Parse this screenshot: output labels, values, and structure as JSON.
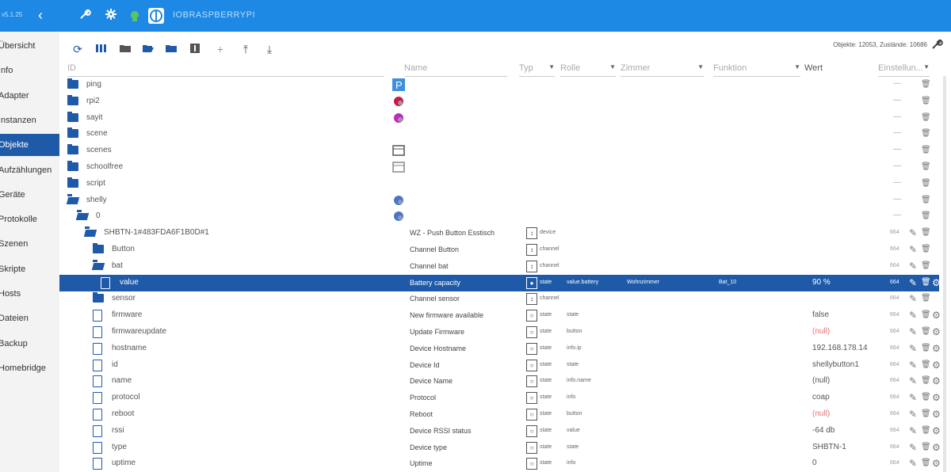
{
  "sidebar": {
    "version": "v5.1.25",
    "items": [
      {
        "label": "Übersicht",
        "active": false
      },
      {
        "label": "Info",
        "active": false
      },
      {
        "label": "Adapter",
        "active": false
      },
      {
        "label": "Instanzen",
        "active": false
      },
      {
        "label": "Objekte",
        "active": true
      },
      {
        "label": "Aufzählungen",
        "active": false
      },
      {
        "label": "Geräte",
        "active": false
      },
      {
        "label": "Protokolle",
        "active": false
      },
      {
        "label": "Szenen",
        "active": false
      },
      {
        "label": "Skripte",
        "active": false
      },
      {
        "label": "Hosts",
        "active": false
      },
      {
        "label": "Dateien",
        "active": false
      },
      {
        "label": "Backup",
        "active": false
      },
      {
        "label": "Homebridge",
        "active": false
      }
    ]
  },
  "topbar": {
    "host": "IOBRASPBERRYPI"
  },
  "main": {
    "counts": "Objekte: 12053, Zustände: 10686",
    "columns": {
      "id": "ID",
      "name": "Name",
      "type": "Typ",
      "role": "Rolle",
      "room": "Zimmer",
      "function": "Funktion",
      "value": "Wert",
      "settings": "Einstellun..."
    },
    "rows": [
      {
        "label": "ping",
        "icon": "folder",
        "level": 0
      },
      {
        "label": "rpi2",
        "icon": "folder",
        "level": 0
      },
      {
        "label": "sayit",
        "icon": "folder",
        "level": 0
      },
      {
        "label": "scene",
        "icon": "folder",
        "level": 0
      },
      {
        "label": "scenes",
        "icon": "folder",
        "level": 0
      },
      {
        "label": "schoolfree",
        "icon": "folder",
        "level": 0
      },
      {
        "label": "script",
        "icon": "folder",
        "level": 0
      },
      {
        "label": "shelly",
        "icon": "folder-open",
        "level": 0
      },
      {
        "label": "0",
        "icon": "folder-open",
        "level": 1
      },
      {
        "label": "SHBTN-1#483FDA6F1B0D#1",
        "icon": "folder-open",
        "level": 2,
        "name": "WZ - Push Button Esstisch",
        "type": "device",
        "acl": "664"
      },
      {
        "label": "Button",
        "icon": "folder",
        "level": 3,
        "name": "Channel Button",
        "type": "channel",
        "acl": "664"
      },
      {
        "label": "bat",
        "icon": "folder-open",
        "level": 3,
        "name": "Channel bat",
        "type": "channel",
        "acl": "664"
      },
      {
        "label": "value",
        "icon": "file",
        "level": 4,
        "name": "Battery capacity",
        "type": "state",
        "role": "value.battery",
        "room": "Wohnzimmer",
        "function": "Bat_10",
        "value": "90 %",
        "acl": "664",
        "selected": true
      },
      {
        "label": "sensor",
        "icon": "folder",
        "level": 3,
        "name": "Channel sensor",
        "type": "channel",
        "acl": "664"
      },
      {
        "label": "firmware",
        "icon": "file",
        "level": 3,
        "name": "New firmware available",
        "type": "state",
        "role": "state",
        "value": "false",
        "acl": "664"
      },
      {
        "label": "firmwareupdate",
        "icon": "file",
        "level": 3,
        "name": "Update Firmware",
        "type": "state",
        "role": "button",
        "value": "(null)",
        "red": true,
        "acl": "664"
      },
      {
        "label": "hostname",
        "icon": "file",
        "level": 3,
        "name": "Device Hostname",
        "type": "state",
        "role": "info.ip",
        "value": "192.168.178.14",
        "acl": "664"
      },
      {
        "label": "id",
        "icon": "file",
        "level": 3,
        "name": "Device Id",
        "type": "state",
        "role": "state",
        "value": "shellybutton1",
        "acl": "664"
      },
      {
        "label": "name",
        "icon": "file",
        "level": 3,
        "name": "Device Name",
        "type": "state",
        "role": "info.name",
        "value": "(null)",
        "acl": "664"
      },
      {
        "label": "protocol",
        "icon": "file",
        "level": 3,
        "name": "Protocol",
        "type": "state",
        "role": "info",
        "value": "coap",
        "acl": "664"
      },
      {
        "label": "reboot",
        "icon": "file",
        "level": 3,
        "name": "Reboot",
        "type": "state",
        "role": "button",
        "value": "(null)",
        "red": true,
        "acl": "664"
      },
      {
        "label": "rssi",
        "icon": "file",
        "level": 3,
        "name": "Device RSSI status",
        "type": "state",
        "role": "value",
        "value": "-64 db",
        "acl": "664"
      },
      {
        "label": "type",
        "icon": "file",
        "level": 3,
        "name": "Device type",
        "type": "state",
        "role": "state",
        "value": "SHBTN-1",
        "acl": "664"
      },
      {
        "label": "uptime",
        "icon": "file",
        "level": 3,
        "name": "Uptime",
        "type": "state",
        "role": "info",
        "value": "0",
        "acl": "664"
      }
    ]
  },
  "colors": {
    "accent": "#1e88e5",
    "selected": "#1e5aa8",
    "null": "#e57373"
  }
}
